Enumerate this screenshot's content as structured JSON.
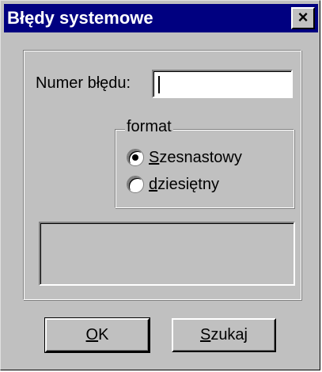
{
  "window": {
    "title": "Błędy systemowe",
    "close_label": "×"
  },
  "form": {
    "error_number_label": "Numer błędu:",
    "error_number_value": "",
    "format_group_label": "format",
    "options": [
      {
        "label_prefix": "S",
        "label_rest": "zesnastowy",
        "selected": true
      },
      {
        "label_prefix": "d",
        "label_rest": "ziesiętny",
        "selected": false
      }
    ],
    "message_text": ""
  },
  "buttons": {
    "ok_prefix": "O",
    "ok_rest": "K",
    "search_prefix": "S",
    "search_rest": "zukaj"
  },
  "colors": {
    "titlebar": "#000080",
    "face": "#c0c0c0"
  }
}
